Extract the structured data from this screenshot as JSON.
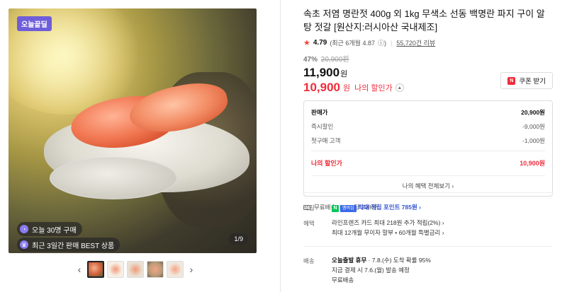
{
  "gallery": {
    "top_badge": "오늘끝딜",
    "chip_today": "오늘 30명 구매",
    "chip_best": "최근 3일간 판매 BEST 상품",
    "counter": "1/9",
    "thumbs": [
      "thumb-1",
      "thumb-2",
      "thumb-3",
      "thumb-4",
      "thumb-5"
    ],
    "prev": "‹",
    "next": "›"
  },
  "product": {
    "title": "속초 저염 명란젓 400g 외 1kg 무색소 선동 백명란 파지 구이 알탕 젓갈 [원산지:러시아산 국내제조]",
    "rating": "4.79",
    "rating_detail": "(최근 6개월 4.87",
    "reviews": "55,720건 리뷰",
    "discount_rate": "47%",
    "original_price": "20,900원",
    "price": "11,900",
    "price_unit": "원",
    "my_price": "10,900",
    "my_price_unit": "원",
    "my_price_label": "나의 할인가",
    "coupon_label": "쿠폰 받기",
    "coupon_badge": "N"
  },
  "breakdown": {
    "rows": [
      {
        "label": "판매가",
        "value": "20,900원"
      },
      {
        "label": "즉시할인",
        "value": "-9,000원"
      },
      {
        "label": "첫구매 고객",
        "value": "-1,000원"
      }
    ],
    "total_label": "나의 할인가",
    "total_value": "10,900원",
    "all_benefits": "나의 혜택 전체보기 ›"
  },
  "shipping": {
    "label": "무료배송",
    "per_gram": "10g당 298원"
  },
  "points": {
    "label": "적립",
    "npay": "N",
    "plus": "멤버십",
    "text": "최대 적립 포인트 785원 ›"
  },
  "benefits": {
    "label": "혜택",
    "line1": "라인프렌즈 카드 최대 218원 추가 적립(2%) ›",
    "line2": "최대 12개월 무이자 할부 • 60개월 특별금리 ›"
  },
  "delivery": {
    "label": "배송",
    "today_label": "오늘출발 휴무",
    "arrival": "· 7.8.(수) 도착 확률 95%",
    "line2": "지금 결제 시 7.6.(월) 발송 예정",
    "line3": "무료배송"
  }
}
